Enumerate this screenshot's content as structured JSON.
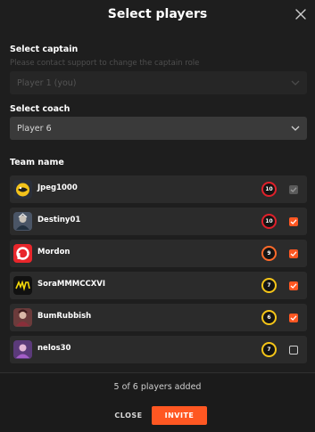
{
  "dialog": {
    "title": "Select players"
  },
  "captain": {
    "label": "Select captain",
    "note": "Please contact support to change the captain role",
    "value": "Player 1 (you)"
  },
  "coach": {
    "label": "Select coach",
    "value": "Player 6"
  },
  "team": {
    "label": "Team name",
    "players": [
      {
        "name": "Jpeg1000",
        "rating": "10",
        "checked": true,
        "locked": true,
        "avatar_icon": "yellow-monster-icon"
      },
      {
        "name": "Destiny01",
        "rating": "10",
        "checked": true,
        "locked": false,
        "avatar_icon": "character-portrait-icon"
      },
      {
        "name": "Mordon",
        "rating": "9",
        "checked": true,
        "locked": false,
        "avatar_icon": "red-p-logo-icon"
      },
      {
        "name": "SoraMMMCCXVI",
        "rating": "7",
        "checked": true,
        "locked": false,
        "avatar_icon": "navi-logo-icon"
      },
      {
        "name": "BumRubbish",
        "rating": "6",
        "checked": true,
        "locked": false,
        "avatar_icon": "character-portrait-icon"
      },
      {
        "name": "nelos30",
        "rating": "7",
        "checked": false,
        "locked": false,
        "avatar_icon": "purple-character-icon"
      }
    ]
  },
  "footer": {
    "count_text": "5 of 6 players added",
    "close_label": "CLOSE",
    "invite_label": "INVITE"
  },
  "colors": {
    "accent": "#ff5722",
    "rating_10": "#e0202a",
    "rating_9": "#ff6a2a",
    "rating_7": "#f5c518",
    "rating_6": "#f5c518"
  }
}
